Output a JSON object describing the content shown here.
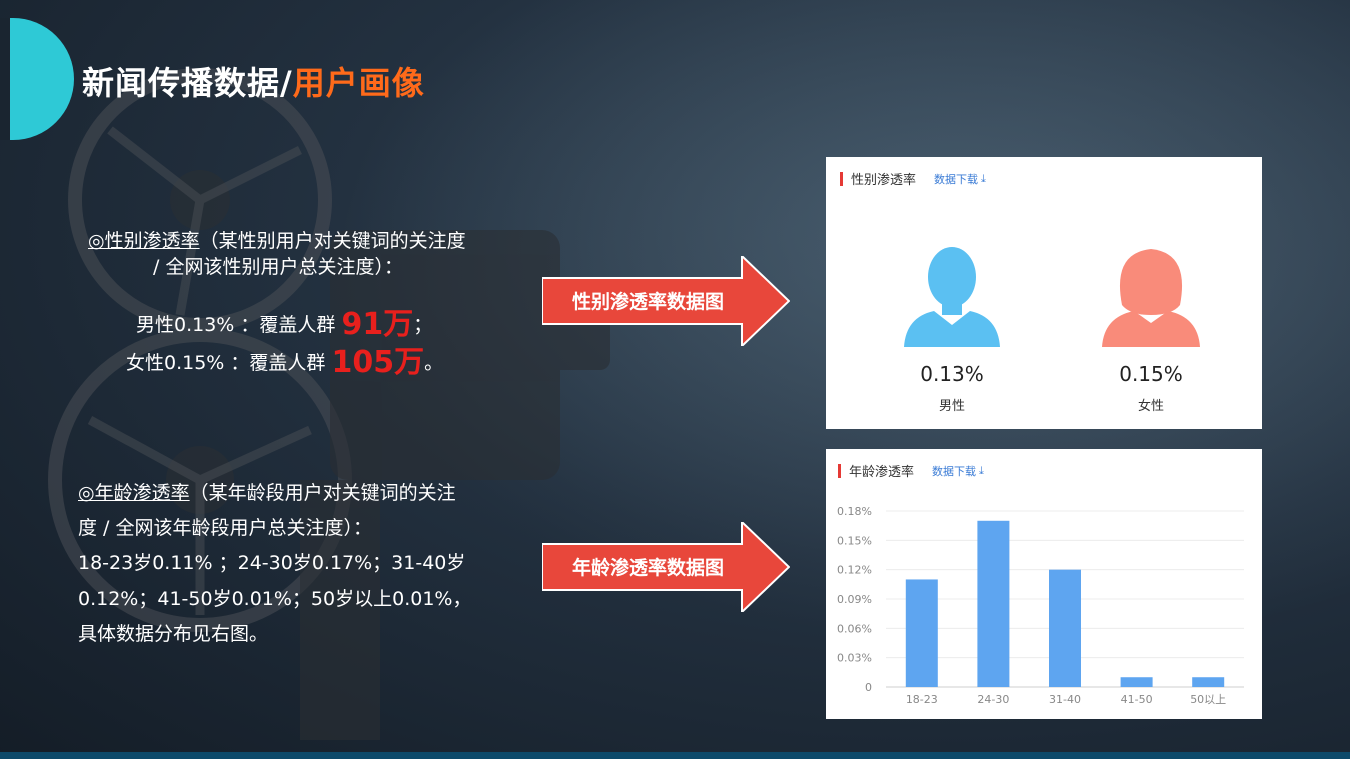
{
  "page": {
    "title_main": "新闻传播数据/",
    "title_highlight": "用户画像"
  },
  "gender_text": {
    "heading_link": "◎性别渗透率",
    "heading_rest": "（某性别用户对关键词的关注度",
    "heading_line2": "/ 全网该性别用户总关注度）：",
    "male_prefix": "男性0.13% ：覆盖人群",
    "male_big": "91万",
    "male_suffix": "；",
    "female_prefix": "女性0.15% ：覆盖人群",
    "female_big": "105万",
    "female_suffix": "。"
  },
  "age_text": {
    "heading_link": "◎年龄渗透率",
    "heading_rest": "（某年龄段用户对关键词的关注",
    "line2": "度 / 全网该年龄段用户总关注度）：",
    "line3": "18-23岁0.11% ；24-30岁0.17%；31-40岁",
    "line4": "0.12%；41-50岁0.01%；50岁以上0.01%，",
    "line5": "具体数据分布见右图。"
  },
  "arrows": {
    "gender": "性别渗透率数据图",
    "age": "年龄渗透率数据图"
  },
  "colors": {
    "accent_cyan": "#2ec9d6",
    "title_orange": "#ff6a1a",
    "arrow_red": "#e8473b",
    "big_number_red": "#e8201d",
    "male_blue": "#5bc0f2",
    "female_salmon": "#f98b7a",
    "bar_blue": "#5ea5f0"
  },
  "gender_card": {
    "title": "性别渗透率",
    "download": "数据下载",
    "download_icon": "download-icon",
    "male": {
      "pct": "0.13%",
      "label": "男性",
      "icon": "male-user-icon"
    },
    "female": {
      "pct": "0.15%",
      "label": "女性",
      "icon": "female-user-icon"
    }
  },
  "age_card": {
    "title": "年龄渗透率",
    "download": "数据下载"
  },
  "chart_data": {
    "type": "bar",
    "categories": [
      "18-23",
      "24-30",
      "31-40",
      "41-50",
      "50以上"
    ],
    "values": [
      0.11,
      0.17,
      0.12,
      0.01,
      0.01
    ],
    "unit": "%",
    "ylim": [
      0,
      0.18
    ],
    "yticks": [
      "0",
      "0.03%",
      "0.06%",
      "0.09%",
      "0.12%",
      "0.15%",
      "0.18%"
    ],
    "grid": true
  }
}
